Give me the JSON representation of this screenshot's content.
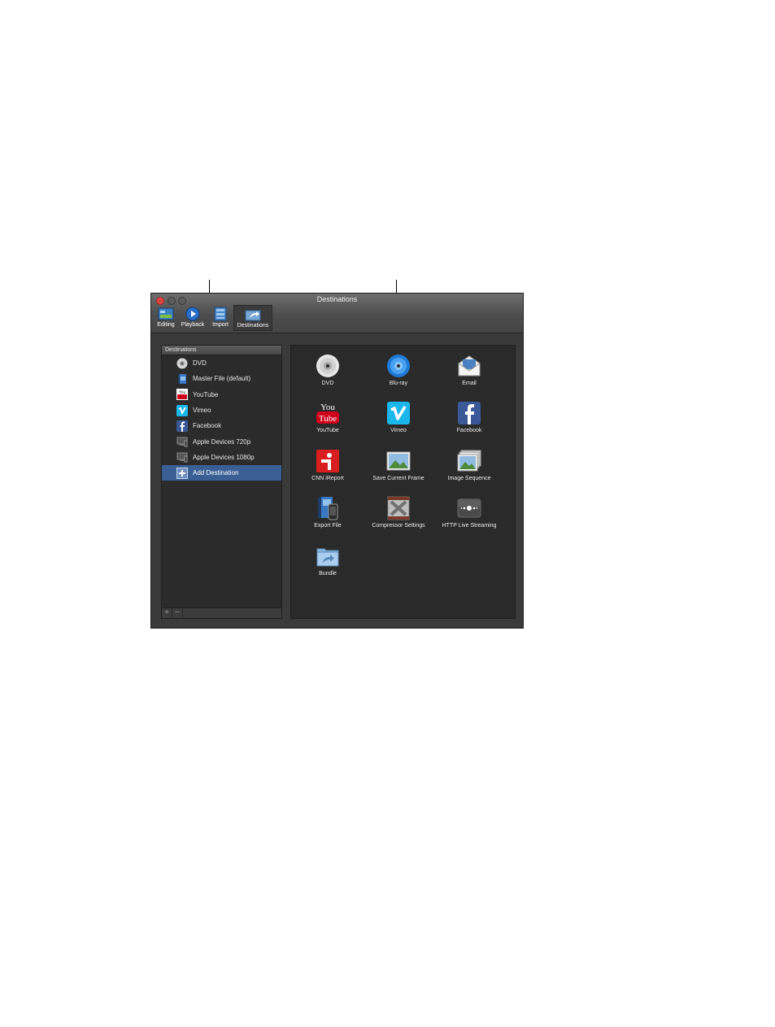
{
  "window": {
    "title": "Destinations"
  },
  "toolbar": {
    "items": [
      {
        "label": "Editing"
      },
      {
        "label": "Playback"
      },
      {
        "label": "Import"
      },
      {
        "label": "Destinations"
      }
    ]
  },
  "sidebar": {
    "header": "Destinations",
    "items": [
      {
        "label": "DVD",
        "icon": "dvd-icon"
      },
      {
        "label": "Master File (default)",
        "icon": "master-file-icon"
      },
      {
        "label": "YouTube",
        "icon": "youtube-icon"
      },
      {
        "label": "Vimeo",
        "icon": "vimeo-icon"
      },
      {
        "label": "Facebook",
        "icon": "facebook-icon"
      },
      {
        "label": "Apple Devices 720p",
        "icon": "apple-devices-icon"
      },
      {
        "label": "Apple Devices 1080p",
        "icon": "apple-devices-icon"
      },
      {
        "label": "Add Destination",
        "icon": "add-destination-icon",
        "selected": true
      }
    ],
    "footer": {
      "add": "+",
      "remove": "−"
    }
  },
  "grid": {
    "tiles": [
      {
        "label": "DVD",
        "icon": "dvd-icon"
      },
      {
        "label": "Blu-ray",
        "icon": "bluray-icon"
      },
      {
        "label": "Email",
        "icon": "email-icon"
      },
      {
        "label": "YouTube",
        "icon": "youtube-icon"
      },
      {
        "label": "Vimeo",
        "icon": "vimeo-icon"
      },
      {
        "label": "Facebook",
        "icon": "facebook-icon"
      },
      {
        "label": "CNN iReport",
        "icon": "cnn-ireport-icon"
      },
      {
        "label": "Save Current Frame",
        "icon": "save-frame-icon"
      },
      {
        "label": "Image Sequence",
        "icon": "image-sequence-icon"
      },
      {
        "label": "Export File",
        "icon": "export-file-icon"
      },
      {
        "label": "Compressor Settings",
        "icon": "compressor-icon"
      },
      {
        "label": "HTTP Live Streaming",
        "icon": "http-streaming-icon"
      },
      {
        "label": "Bundle",
        "icon": "bundle-icon"
      }
    ]
  },
  "colors": {
    "selection": "#3a5f95",
    "close_button": "#e0443e"
  }
}
